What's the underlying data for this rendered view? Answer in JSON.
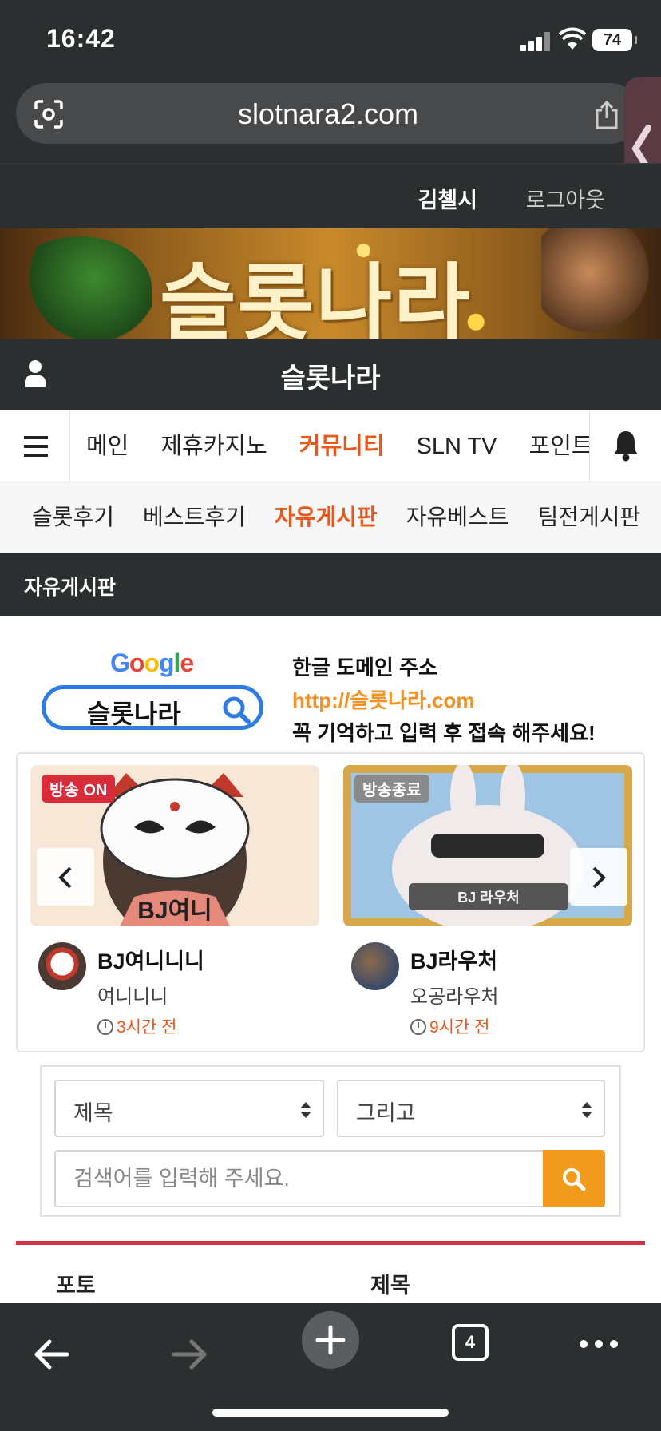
{
  "status": {
    "time": "16:42",
    "battery": "74"
  },
  "browser": {
    "url": "slotnara2.com",
    "tab_count": "4"
  },
  "userbar": {
    "username": "김첼시",
    "logout": "로그아웃"
  },
  "banner": {
    "title": "슬롯나라"
  },
  "site": {
    "title": "슬롯나라"
  },
  "main_nav": {
    "items": [
      "메인",
      "제휴카지노",
      "커뮤니티",
      "SLN TV",
      "포인트"
    ],
    "active_index": 2
  },
  "sub_nav": {
    "items": [
      "슬롯후기",
      "베스트후기",
      "자유게시판",
      "자유베스트",
      "팀전게시판"
    ],
    "active_index": 2
  },
  "section": {
    "title": "자유게시판"
  },
  "domain_ad": {
    "google": [
      "G",
      "o",
      "o",
      "g",
      "l",
      "e"
    ],
    "search_text": "슬롯나라",
    "line1": "한글 도메인 주소",
    "line2": "http://슬롯나라.com",
    "line3": "꼭 기억하고 입력 후 접속 해주세요!"
  },
  "bj_cards": [
    {
      "badge": "방송 ON",
      "badge_color": "#d92b3a",
      "thumb_caption": "BJ여니",
      "name": "BJ여니니니",
      "nick": "여니니니",
      "ago": "3시간 전"
    },
    {
      "badge": "방송종료",
      "badge_color": "#8a8a8a",
      "thumb_caption": "BJ 라우처",
      "name": "BJ라우처",
      "nick": "오공라우처",
      "ago": "9시간 전"
    }
  ],
  "search": {
    "field_select": "제목",
    "logic_select": "그리고",
    "placeholder": "검색어를 입력해 주세요."
  },
  "list_header": {
    "col1": "포토",
    "col2": "제목"
  },
  "colors": {
    "accent": "#e8581c",
    "dark": "#2c2f30",
    "search_button": "#f29a1c",
    "list_rule": "#d33340"
  }
}
